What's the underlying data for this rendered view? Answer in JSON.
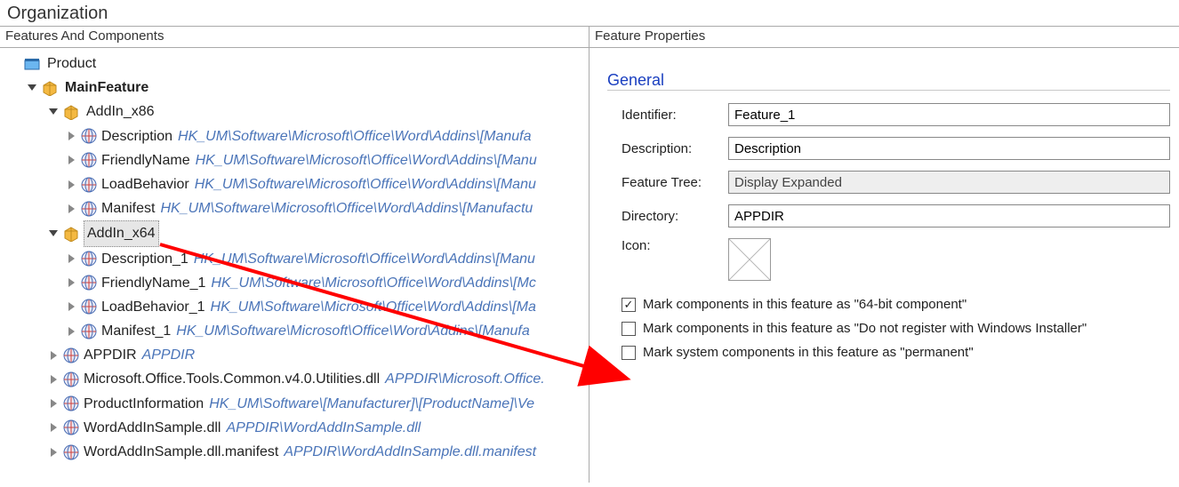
{
  "title": "Organization",
  "leftHeader": "Features And Components",
  "rightHeader": "Feature Properties",
  "tree": {
    "product": "Product",
    "mainFeature": "MainFeature",
    "addin86": "AddIn_x86",
    "addin86_items": [
      {
        "name": "Description",
        "path": "HK_UM\\Software\\Microsoft\\Office\\Word\\Addins\\[Manufa"
      },
      {
        "name": "FriendlyName",
        "path": "HK_UM\\Software\\Microsoft\\Office\\Word\\Addins\\[Manu"
      },
      {
        "name": "LoadBehavior",
        "path": "HK_UM\\Software\\Microsoft\\Office\\Word\\Addins\\[Manu"
      },
      {
        "name": "Manifest",
        "path": "HK_UM\\Software\\Microsoft\\Office\\Word\\Addins\\[Manufactu"
      }
    ],
    "addin64": "AddIn_x64",
    "addin64_items": [
      {
        "name": "Description_1",
        "path": "HK_UM\\Software\\Microsoft\\Office\\Word\\Addins\\[Manu"
      },
      {
        "name": "FriendlyName_1",
        "path": "HK_UM\\Software\\Microsoft\\Office\\Word\\Addins\\[Mc"
      },
      {
        "name": "LoadBehavior_1",
        "path": "HK_UM\\Software\\Microsoft\\Office\\Word\\Addins\\[Ma"
      },
      {
        "name": "Manifest_1",
        "path": "HK_UM\\Software\\Microsoft\\Office\\Word\\Addins\\[Manufa"
      }
    ],
    "extras": [
      {
        "name": "APPDIR",
        "path": "APPDIR",
        "icon": "reg"
      },
      {
        "name": "Microsoft.Office.Tools.Common.v4.0.Utilities.dll",
        "path": "APPDIR\\Microsoft.Office.",
        "icon": "reg"
      },
      {
        "name": "ProductInformation",
        "path": "HK_UM\\Software\\[Manufacturer]\\[ProductName]\\Ve",
        "icon": "reg"
      },
      {
        "name": "WordAddInSample.dll",
        "path": "APPDIR\\WordAddInSample.dll",
        "icon": "reg"
      },
      {
        "name": "WordAddInSample.dll.manifest",
        "path": "APPDIR\\WordAddInSample.dll.manifest",
        "icon": "reg"
      }
    ]
  },
  "props": {
    "section": "General",
    "identifier_label": "Identifier:",
    "identifier_value": "Feature_1",
    "description_label": "Description:",
    "description_value": "Description",
    "featuretree_label": "Feature Tree:",
    "featuretree_value": "Display Expanded",
    "directory_label": "Directory:",
    "directory_value": "APPDIR",
    "icon_label": "Icon:",
    "check1": "Mark components in this feature as \"64-bit component\"",
    "check2": "Mark components in this feature as \"Do not register with Windows Installer\"",
    "check3": "Mark system components in this feature as \"permanent\""
  }
}
